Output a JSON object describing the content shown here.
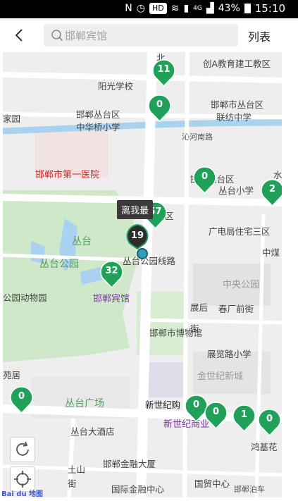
{
  "status_bar": {
    "battery_percent": "43%",
    "time": "15:10",
    "hd": "HD",
    "network": "4G"
  },
  "header": {
    "search_placeholder": "邯郸宾馆",
    "list_label": "列表"
  },
  "colors": {
    "marker_green": "#21a05a",
    "marker_dark": "#2d2d2d",
    "park": "#cfe8c9",
    "road": "#ffffff"
  },
  "map": {
    "labels": {
      "chuangA": "创A教育建工教区",
      "yangguang": "阳光学校",
      "jiayuan": "家园",
      "hanshan_zhonghua": "邯郸丛台区",
      "zhonghua_school": "中华桥小学",
      "hanshan_lianyou": "邯郸市丛台区",
      "lianyou_school": "联纺中学",
      "qinhe_road": "沁河南路",
      "hospital": "邯郸市第一医院",
      "congtai_district": "邯郸丛台区",
      "congtai_school": "丛台小学",
      "shui": "水",
      "guangdian": "广电局住宅三区",
      "zhongmei": "中煤",
      "congtai": "丛台",
      "congtai_park": "丛台公园",
      "route": "丛台公园线路",
      "zoo": "公园动物园",
      "hotel": "邯郸宾馆",
      "zhongyang_park": "中央公园",
      "zhanhou": "展后",
      "jie": "街",
      "chunchang": "春厂前街",
      "museum": "邯郸市博物馆",
      "zhanlanlu_school": "展览路小学",
      "jinshiji": "金世纪新城",
      "yuju": "苑居",
      "congtai_square": "丛台广场",
      "xinshiji": "新世纪购",
      "xinshiji_commerce": "新世纪商业",
      "congtai_hotel": "丛台大酒店",
      "honghua": "鸿基花",
      "finance_building": "邯郸金融大厦",
      "tushan": "土山",
      "tushan_jie": "街",
      "intl_finance": "国际金融中心",
      "guomao": "国贸中心",
      "qu": "区",
      "beixing": "北"
    },
    "markers": [
      {
        "count": "11",
        "name": "marker-11"
      },
      {
        "count": "0",
        "name": "marker-0-a"
      },
      {
        "count": "0",
        "name": "marker-0-b"
      },
      {
        "count": "2",
        "name": "marker-2"
      },
      {
        "count": "57",
        "name": "marker-57"
      },
      {
        "count": "32",
        "name": "marker-32"
      },
      {
        "count": "0",
        "name": "marker-0-c"
      },
      {
        "count": "0",
        "name": "marker-0-d"
      },
      {
        "count": "0",
        "name": "marker-0-e"
      },
      {
        "count": "1",
        "name": "marker-1"
      },
      {
        "count": "0",
        "name": "marker-0-f"
      }
    ],
    "current_location": {
      "count": "19",
      "tooltip": "离我最"
    }
  },
  "watermark": "邯郸泊车",
  "baidu_logo": "Bai du 地图"
}
